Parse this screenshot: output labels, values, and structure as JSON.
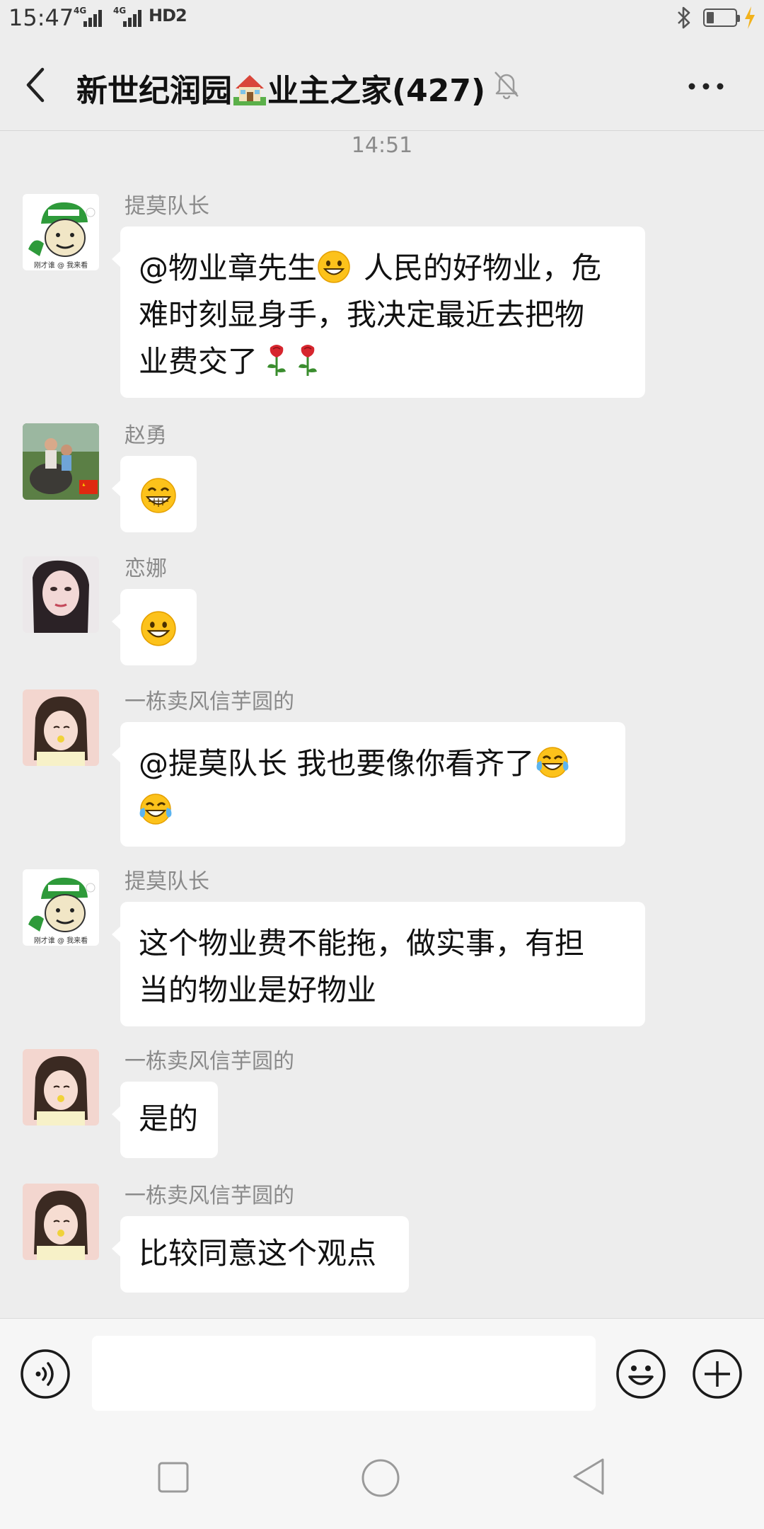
{
  "status_bar": {
    "time": "15:47",
    "signal_1": "4G",
    "signal_2": "4G",
    "hd": "HD2"
  },
  "header": {
    "title_part1": "新世纪润园",
    "title_part2": "业主之家(427)"
  },
  "chat": {
    "timestamp": "14:51",
    "messages": [
      {
        "sender": "提莫队长",
        "avatar_caption": "刚才谁 @ 我来看",
        "lines": [
          "@物业章先生",
          "人民的好物业，危",
          "难时刻显身手，我决定最近去把物",
          "业费交了"
        ]
      },
      {
        "sender": "赵勇"
      },
      {
        "sender": "恋娜"
      },
      {
        "sender": "一栋卖风信芋圆的",
        "lines": [
          "@提莫队长  我也要像你看齐了"
        ]
      },
      {
        "sender": "提莫队长",
        "avatar_caption": "刚才谁 @ 我来看",
        "lines": [
          "这个物业费不能拖，做实事，有担",
          "当的物业是好物业"
        ]
      },
      {
        "sender": "一栋卖风信芋圆的",
        "lines": [
          "是的"
        ]
      },
      {
        "sender": "一栋卖风信芋圆的",
        "lines": [
          "比较同意这个观点"
        ]
      }
    ]
  },
  "colors": {
    "background": "#ededed",
    "bubble": "#ffffff",
    "bar": "#f6f6f6"
  }
}
